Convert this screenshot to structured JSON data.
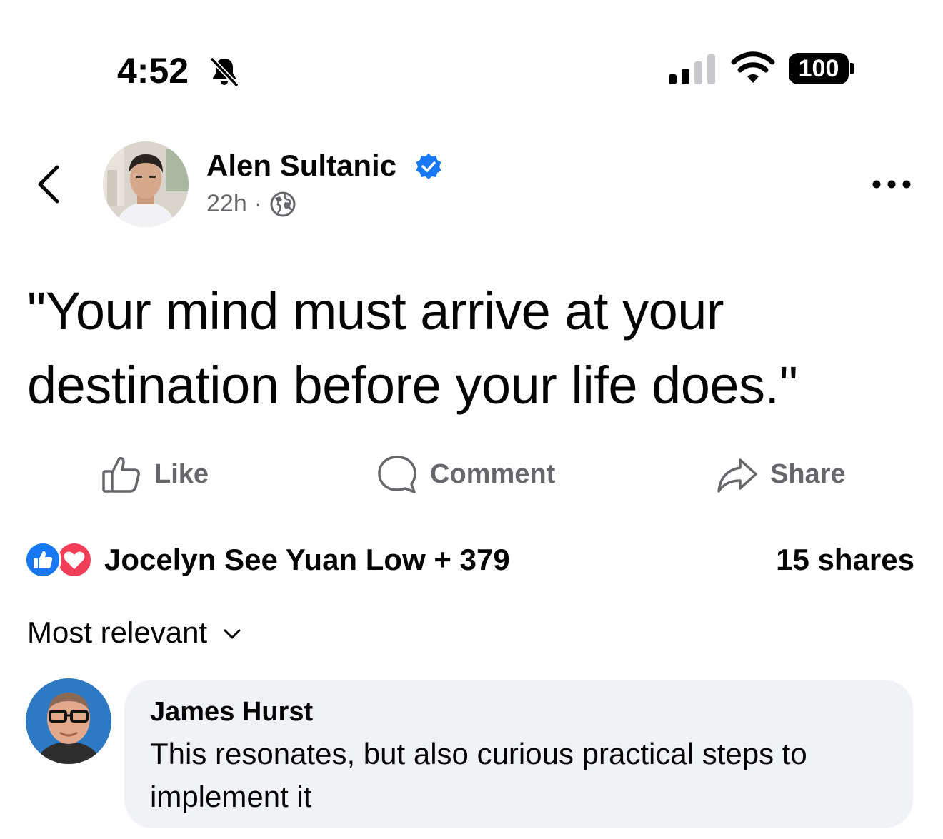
{
  "status_bar": {
    "time": "4:52",
    "battery": "100",
    "icons": [
      "bell-slash-icon",
      "cellular-signal-icon",
      "wifi-icon",
      "battery-icon"
    ]
  },
  "post": {
    "author": "Alen Sultanic",
    "verified": true,
    "time_ago": "22h",
    "separator": "·",
    "audience_icon": "globe-icon",
    "text": "\"Your mind must arrive at your destination before your life does.\""
  },
  "actions": {
    "like": "Like",
    "comment": "Comment",
    "share": "Share"
  },
  "engagement": {
    "reactors": "Jocelyn See Yuan Low + 379",
    "shares": "15 shares",
    "reaction_icons": [
      "like-reaction-icon",
      "love-reaction-icon"
    ]
  },
  "comments_sort": {
    "label": "Most relevant"
  },
  "comments": [
    {
      "author": "James Hurst",
      "text": "This resonates,  but also curious practical steps to implement it"
    }
  ],
  "colors": {
    "brand_blue": "#1877f2",
    "love_red": "#f33e58",
    "muted_gray": "#65676b",
    "bubble_bg": "#f0f2f5"
  }
}
